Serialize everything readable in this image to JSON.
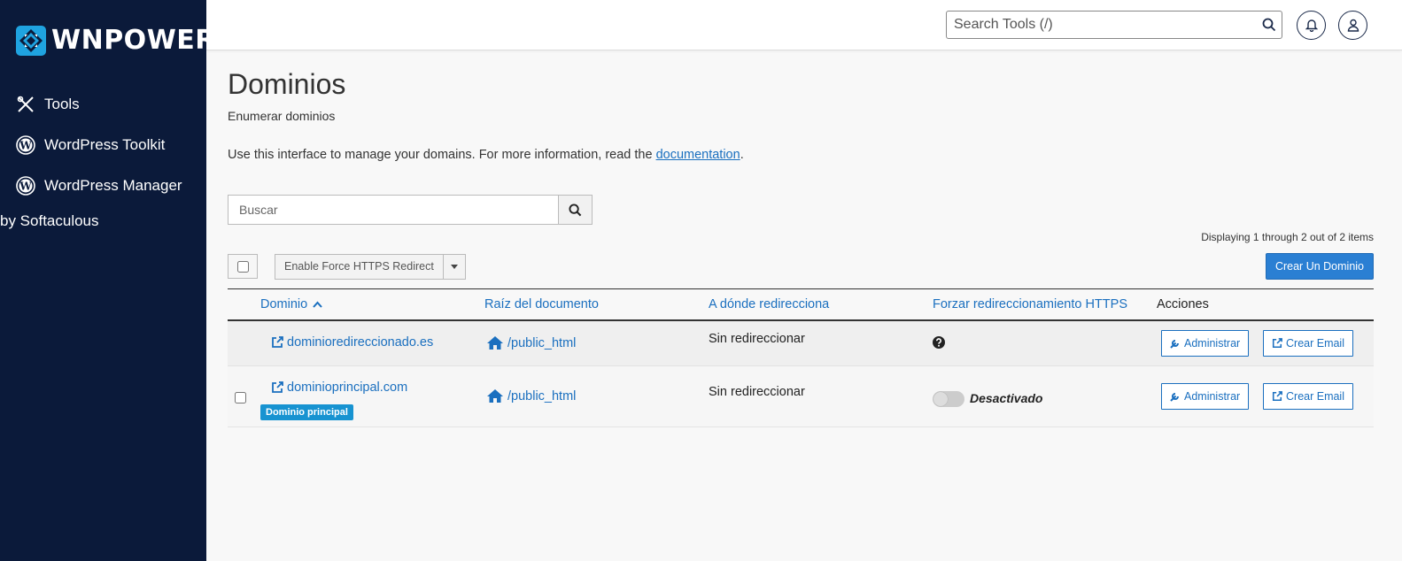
{
  "brand": {
    "name": "WNPOWER",
    "accent": "#1fa3e0"
  },
  "sidebar": {
    "items": [
      {
        "label": "Tools",
        "icon": "tools-icon"
      },
      {
        "label": "WordPress Toolkit",
        "icon": "wordpress-icon"
      },
      {
        "label": "WordPress Manager",
        "label2": "by Softaculous",
        "icon": "wordpress-icon"
      }
    ]
  },
  "topbar": {
    "search_placeholder": "Search Tools (/)"
  },
  "page": {
    "title": "Dominios",
    "subtitle": "Enumerar dominios",
    "intro_text": "Use this interface to manage your domains. For more information, read the ",
    "intro_link": "documentation",
    "intro_end": "."
  },
  "search": {
    "placeholder": "Buscar"
  },
  "list": {
    "displaying": "Displaying 1 through 2 out of 2 items",
    "bulk_action": "Enable Force HTTPS Redirect",
    "create_button": "Crear Un Dominio"
  },
  "table": {
    "columns": [
      "Dominio",
      "Raíz del documento",
      "A dónde redirecciona",
      "Forzar redireccionamiento HTTPS",
      "Acciones"
    ],
    "rows": [
      {
        "domain": "dominioredireccionado.es",
        "docroot": "/public_html",
        "redirect": "Sin redireccionar",
        "https": "",
        "manage": "Administrar",
        "email": "Crear Email"
      },
      {
        "domain": "dominioprincipal.com",
        "badge": "Dominio principal",
        "docroot": "/public_html",
        "redirect": "Sin redireccionar",
        "https": "Desactivado",
        "manage": "Administrar",
        "email": "Crear Email"
      }
    ]
  }
}
